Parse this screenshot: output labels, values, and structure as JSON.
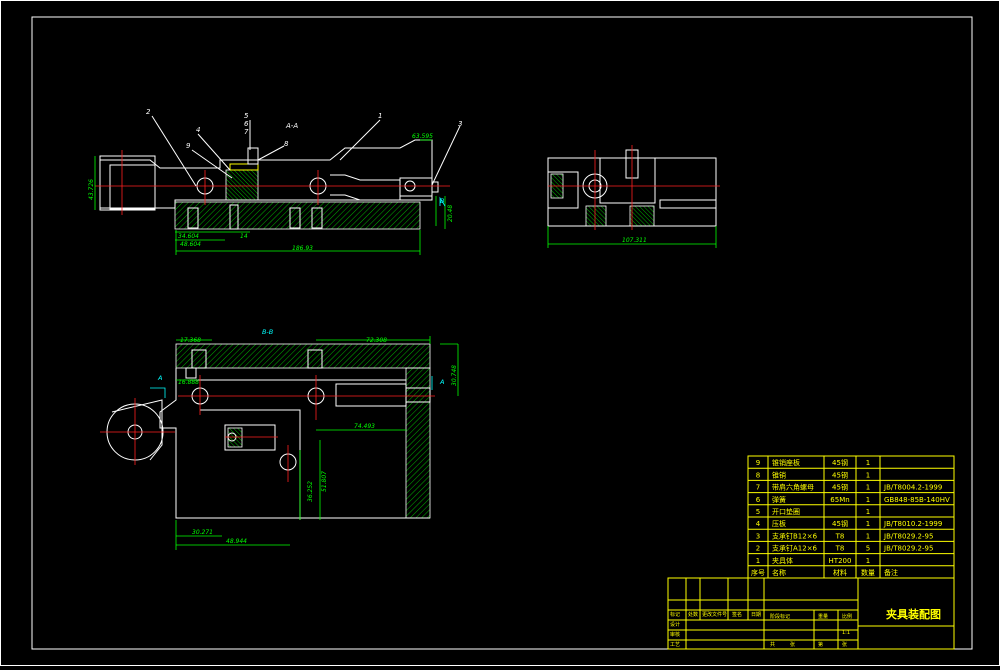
{
  "labels": {
    "callouts": [
      "1",
      "2",
      "3",
      "4",
      "5",
      "6",
      "7",
      "8",
      "9"
    ],
    "section_aa": "A-A",
    "section_bb": "B-B",
    "letter_a": "A",
    "letter_b": "B"
  },
  "dimensions": {
    "d_63_595": "63.595",
    "d_34_604": "34.604",
    "d_14": "14",
    "d_48_604": "48.604",
    "d_186_93": "186.93",
    "d_43_726": "43.726",
    "d_20_48": "20.48",
    "d_107_311": "107.311",
    "d_17_368": "17.368",
    "d_72_308": "72.308",
    "d_16_888": "16.888",
    "d_30_748": "30.748",
    "d_74_493": "74.493",
    "d_30_271": "30.271",
    "d_48_944": "48.944",
    "d_36_252": "36.252",
    "d_51_807": "51.807"
  },
  "bom": {
    "rows": [
      {
        "no": "9",
        "name": "锥销座板",
        "material": "45钢",
        "qty": "1",
        "std": ""
      },
      {
        "no": "8",
        "name": "锥销",
        "material": "45钢",
        "qty": "1",
        "std": ""
      },
      {
        "no": "7",
        "name": "带肩六角螺母",
        "material": "45钢",
        "qty": "1",
        "std": "JB/T8004.2-1999"
      },
      {
        "no": "6",
        "name": "弹簧",
        "material": "65Mn",
        "qty": "1",
        "std": "GB848-85B-140HV"
      },
      {
        "no": "5",
        "name": "开口垫圈",
        "material": "",
        "qty": "1",
        "std": ""
      },
      {
        "no": "4",
        "name": "压板",
        "material": "45钢",
        "qty": "1",
        "std": "JB/T8010.2-1999"
      },
      {
        "no": "3",
        "name": "支承钉B12×6",
        "material": "T8",
        "qty": "1",
        "std": "JB/T8029.2-95"
      },
      {
        "no": "2",
        "name": "支承钉A12×6",
        "material": "T8",
        "qty": "5",
        "std": "JB/T8029.2-95"
      },
      {
        "no": "1",
        "name": "夹具体",
        "material": "HT200",
        "qty": "1",
        "std": ""
      }
    ],
    "header": {
      "no": "序号",
      "name": "名称",
      "material": "材料",
      "qty": "数量",
      "std": "备注"
    }
  },
  "title_block": {
    "title": "夹具装配图",
    "small_labels": [
      "标记",
      "处数",
      "更改文件号",
      "签名",
      "日期",
      "设计",
      "审核",
      "工艺",
      "阶段标记",
      "重量",
      "比例",
      "共",
      "张",
      "第",
      "张",
      "1:1"
    ]
  },
  "colors": {
    "frame": "#ffffff",
    "part": "#ffffff",
    "dimension": "#00ff00",
    "centerline": "#ff2020",
    "text_part": "#00ffff",
    "table": "#ffff00"
  }
}
